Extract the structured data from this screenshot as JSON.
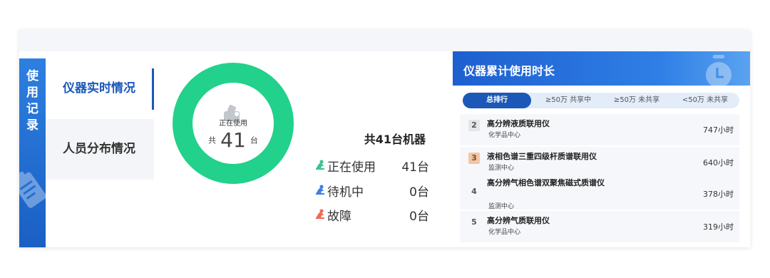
{
  "sidebar_tab": {
    "chars": [
      "使",
      "用",
      "记",
      "录"
    ]
  },
  "nav": {
    "items": [
      {
        "label": "仪器实时情况"
      },
      {
        "label": "人员分布情况"
      }
    ]
  },
  "donut": {
    "label": "正在使用",
    "prefix": "共",
    "count": "41",
    "suffix": "台",
    "colors": {
      "ring": "#22d18b"
    }
  },
  "summary": {
    "text": "共41台机器"
  },
  "status": [
    {
      "label": "正在使用",
      "value": "41台",
      "icon": "green-person-icon",
      "color": "#3cc48f"
    },
    {
      "label": "待机中",
      "value": "0台",
      "icon": "blue-person-icon",
      "color": "#3f7fe0"
    },
    {
      "label": "故障",
      "value": "0台",
      "icon": "red-person-icon",
      "color": "#ef6a55"
    }
  ],
  "ranking": {
    "title": "仪器累计使用时长",
    "tabs": [
      {
        "label": "总排行"
      },
      {
        "label": "≥50万 共享中"
      },
      {
        "label": "≥50万 未共享"
      },
      {
        "label": "<50万 未共享"
      }
    ],
    "rows": [
      {
        "rank": "2",
        "name": "高分辨液质联用仪",
        "dept": "化学品中心",
        "hours": "747小时"
      },
      {
        "rank": "3",
        "name": "液相色谱三重四级杆质谱联用仪",
        "dept": "监测中心",
        "hours": "640小时"
      },
      {
        "rank": "4",
        "name": "高分辨气相色谱双聚焦磁式质谱仪",
        "dept": "监测中心",
        "hours": "378小时"
      },
      {
        "rank": "5",
        "name": "高分辨气质联用仪",
        "dept": "化学品中心",
        "hours": "319小时"
      }
    ]
  },
  "colors": {
    "accent": "#1c58b8",
    "ranking_header": "#1e5fcf"
  }
}
